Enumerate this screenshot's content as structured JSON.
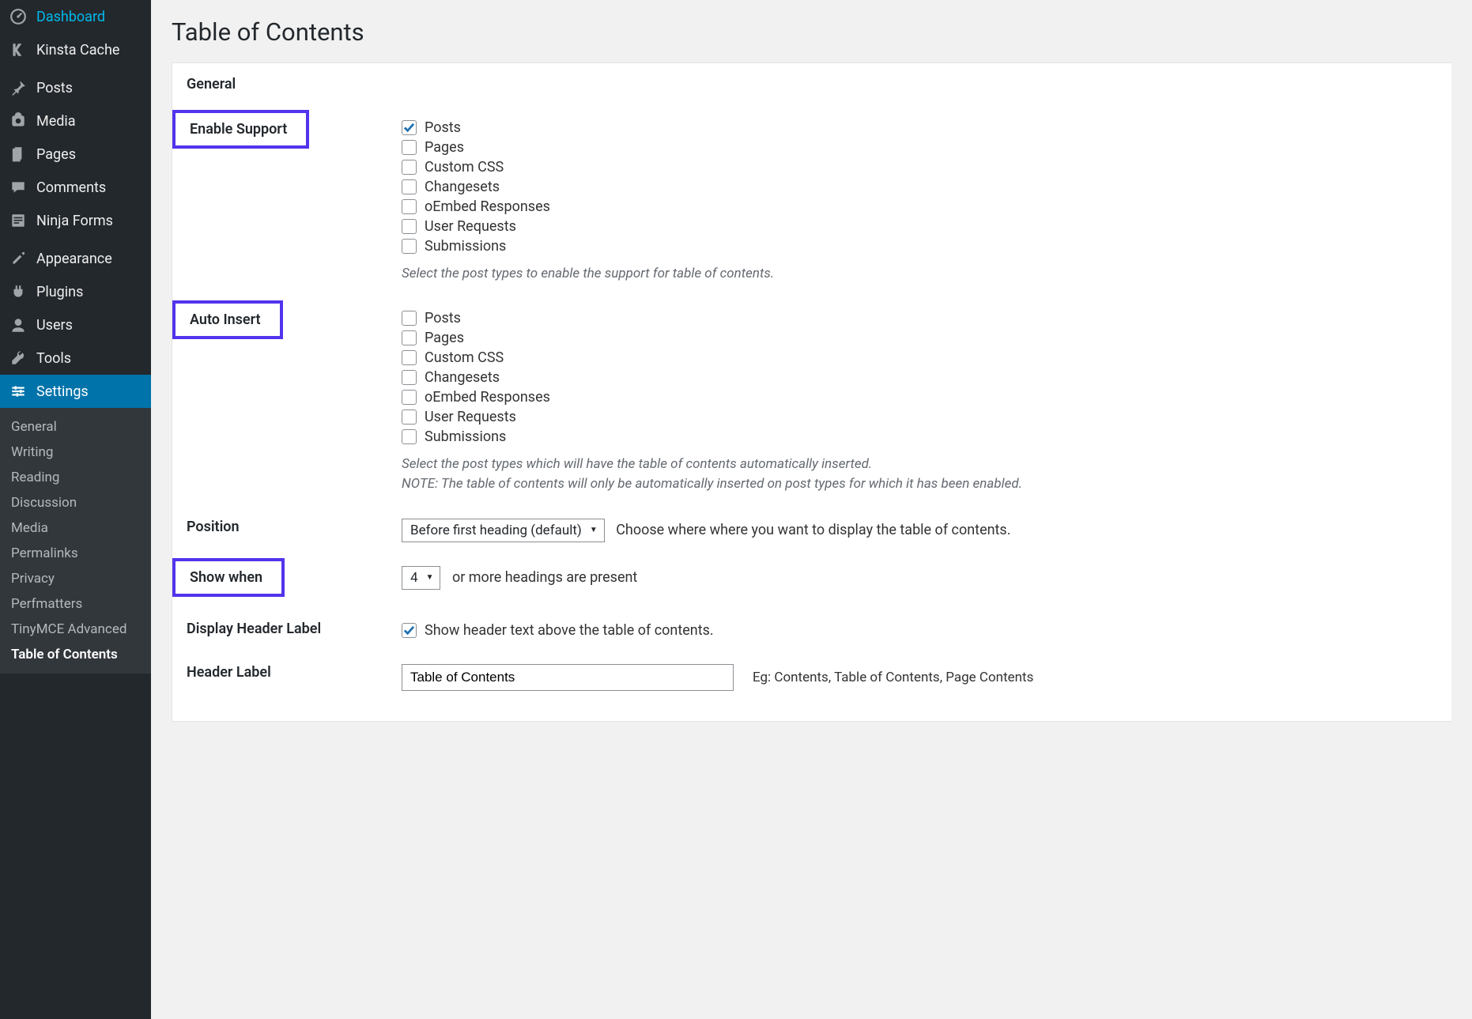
{
  "sidebar": {
    "items": [
      {
        "label": "Dashboard",
        "icon": "dashboard"
      },
      {
        "label": "Kinsta Cache",
        "icon": "kinsta"
      },
      {
        "label": "Posts",
        "icon": "pin"
      },
      {
        "label": "Media",
        "icon": "media"
      },
      {
        "label": "Pages",
        "icon": "pages"
      },
      {
        "label": "Comments",
        "icon": "comments"
      },
      {
        "label": "Ninja Forms",
        "icon": "form"
      },
      {
        "label": "Appearance",
        "icon": "appearance"
      },
      {
        "label": "Plugins",
        "icon": "plugins"
      },
      {
        "label": "Users",
        "icon": "users"
      },
      {
        "label": "Tools",
        "icon": "tools"
      },
      {
        "label": "Settings",
        "icon": "settings"
      }
    ],
    "subitems": [
      {
        "label": "General"
      },
      {
        "label": "Writing"
      },
      {
        "label": "Reading"
      },
      {
        "label": "Discussion"
      },
      {
        "label": "Media"
      },
      {
        "label": "Permalinks"
      },
      {
        "label": "Privacy"
      },
      {
        "label": "Perfmatters"
      },
      {
        "label": "TinyMCE Advanced"
      },
      {
        "label": "Table of Contents",
        "current": true
      }
    ]
  },
  "page": {
    "title": "Table of Contents",
    "section": "General"
  },
  "enable_support": {
    "label": "Enable Support",
    "options": [
      {
        "label": "Posts",
        "checked": true
      },
      {
        "label": "Pages",
        "checked": false
      },
      {
        "label": "Custom CSS",
        "checked": false
      },
      {
        "label": "Changesets",
        "checked": false
      },
      {
        "label": "oEmbed Responses",
        "checked": false
      },
      {
        "label": "User Requests",
        "checked": false
      },
      {
        "label": "Submissions",
        "checked": false
      }
    ],
    "desc": "Select the post types to enable the support for table of contents."
  },
  "auto_insert": {
    "label": "Auto Insert",
    "options": [
      {
        "label": "Posts",
        "checked": false
      },
      {
        "label": "Pages",
        "checked": false
      },
      {
        "label": "Custom CSS",
        "checked": false
      },
      {
        "label": "Changesets",
        "checked": false
      },
      {
        "label": "oEmbed Responses",
        "checked": false
      },
      {
        "label": "User Requests",
        "checked": false
      },
      {
        "label": "Submissions",
        "checked": false
      }
    ],
    "desc1": "Select the post types which will have the table of contents automatically inserted.",
    "desc2": "NOTE: The table of contents will only be automatically inserted on post types for which it has been enabled."
  },
  "position": {
    "label": "Position",
    "value": "Before first heading (default)",
    "suffix": "Choose where where you want to display the table of contents."
  },
  "show_when": {
    "label": "Show when",
    "value": "4",
    "suffix": "or more headings are present"
  },
  "display_header": {
    "label": "Display Header Label",
    "checked": true,
    "text": "Show header text above the table of contents."
  },
  "header_label": {
    "label": "Header Label",
    "value": "Table of Contents",
    "eg": "Eg: Contents, Table of Contents, Page Contents"
  }
}
